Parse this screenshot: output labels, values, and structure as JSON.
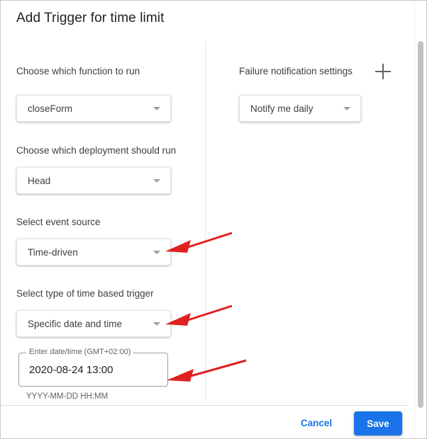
{
  "dialog": {
    "title": "Add Trigger for time limit"
  },
  "left_column": {
    "function_label": "Choose which function to run",
    "function_value": "closeForm",
    "deployment_label": "Choose which deployment should run",
    "deployment_value": "Head",
    "event_source_label": "Select event source",
    "event_source_value": "Time-driven",
    "trigger_type_label": "Select type of time based trigger",
    "trigger_type_value": "Specific date and time",
    "datetime_field_label": "Enter date/time (GMT+02:00)",
    "datetime_value": "2020-08-24 13:00",
    "datetime_helper": "YYYY-MM-DD HH:MM"
  },
  "right_column": {
    "failure_label": "Failure notification settings",
    "add_icon": "plus-icon",
    "notification_value": "Notify me daily"
  },
  "footer": {
    "cancel_label": "Cancel",
    "save_label": "Save"
  },
  "colors": {
    "accent": "#1a73e8",
    "annotation": "#e02020",
    "text_primary": "#202124",
    "text_secondary": "#3c4043",
    "caret": "#9aa0a6"
  }
}
